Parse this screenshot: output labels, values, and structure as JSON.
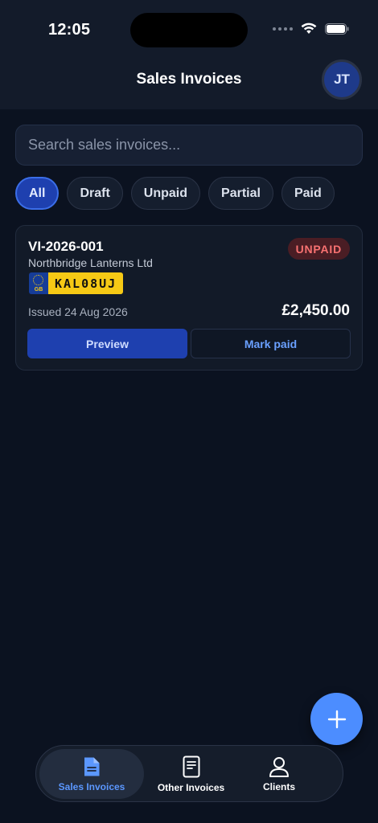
{
  "status_bar": {
    "time": "12:05"
  },
  "header": {
    "title": "Sales Invoices",
    "avatar_initials": "JT"
  },
  "search": {
    "placeholder": "Search sales invoices...",
    "value": ""
  },
  "filters": [
    {
      "label": "All",
      "active": true
    },
    {
      "label": "Draft",
      "active": false
    },
    {
      "label": "Unpaid",
      "active": false
    },
    {
      "label": "Partial",
      "active": false
    },
    {
      "label": "Paid",
      "active": false
    }
  ],
  "invoices": [
    {
      "number": "VI-2026-001",
      "client": "Northbridge Lanterns Ltd",
      "status": "UNPAID",
      "plate": {
        "country": "GB",
        "registration": "KAL08UJ"
      },
      "issued": "Issued 24 Aug 2026",
      "amount": "£2,450.00",
      "preview_label": "Preview",
      "mark_paid_label": "Mark paid"
    }
  ],
  "fab": {
    "icon": "plus-icon"
  },
  "tabs": [
    {
      "label": "Sales Invoices",
      "icon": "document-icon",
      "active": true
    },
    {
      "label": "Other Invoices",
      "icon": "receipt-icon",
      "active": false
    },
    {
      "label": "Clients",
      "icon": "person-icon",
      "active": false
    }
  ],
  "colors": {
    "background": "#0b1220",
    "accent": "#4c8dff",
    "primary_button": "#1e40af",
    "unpaid_badge_text": "#f87171",
    "plate_yellow": "#f6c915"
  }
}
